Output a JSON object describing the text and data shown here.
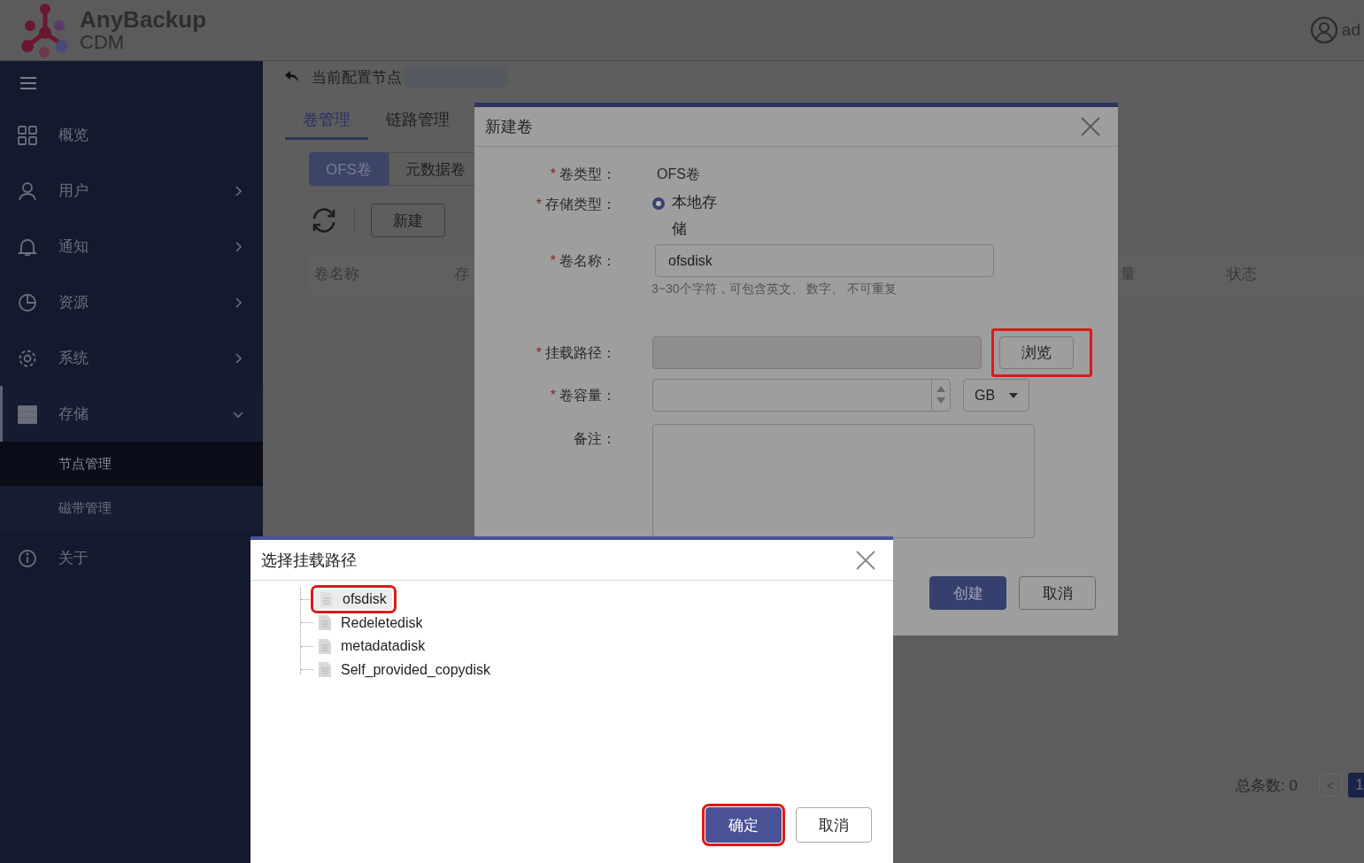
{
  "header": {
    "brand": "AnyBackup",
    "product": "CDM",
    "user": "ad"
  },
  "sidebar": {
    "items": [
      {
        "label": "概览",
        "has_children": false,
        "expanded": false
      },
      {
        "label": "用户",
        "has_children": true,
        "expanded": false
      },
      {
        "label": "通知",
        "has_children": true,
        "expanded": false
      },
      {
        "label": "资源",
        "has_children": true,
        "expanded": false
      },
      {
        "label": "系统",
        "has_children": true,
        "expanded": false
      },
      {
        "label": "存储",
        "has_children": true,
        "expanded": true,
        "children": [
          {
            "label": "节点管理",
            "selected": true
          },
          {
            "label": "磁带管理",
            "selected": false
          }
        ]
      },
      {
        "label": "关于",
        "has_children": false,
        "expanded": false
      }
    ]
  },
  "breadcrumb": {
    "label": "当前配置节点"
  },
  "tabs": [
    {
      "label": "卷管理",
      "selected": true
    },
    {
      "label": "链路管理",
      "selected": false
    }
  ],
  "volume_types": [
    {
      "label": "OFS卷",
      "selected": true
    },
    {
      "label": "元数据卷",
      "selected": false
    }
  ],
  "toolbar": {
    "new_button": "新建"
  },
  "table": {
    "columns": [
      "卷名称",
      "存",
      "量",
      "状态"
    ]
  },
  "pagination": {
    "total": "总条数: 0",
    "prev": "<",
    "prev_disabled": true,
    "pages": [
      {
        "label": "1",
        "selected": true
      }
    ]
  },
  "new_volume_dialog": {
    "title": "新建卷",
    "fields": [
      {
        "kind": "text",
        "required_mark": "*",
        "label": "卷类型：",
        "value": "OFS卷"
      },
      {
        "kind": "radio",
        "required_mark": "*",
        "label": "存储类型：",
        "options": [
          {
            "label": "本地存储",
            "selected": true
          }
        ]
      },
      {
        "kind": "input",
        "required_mark": "*",
        "label": "卷名称：",
        "value": "ofsdisk",
        "hint": "3~30个字符，可包含英文、 数字、 不可重复"
      },
      {
        "kind": "path",
        "required_mark": "*",
        "label": "挂载路径：",
        "disabled": true,
        "button": {
          "label": "浏览",
          "highlighted": true
        }
      },
      {
        "kind": "number",
        "required_mark": "*",
        "label": "卷容量：",
        "unit": "GB"
      },
      {
        "kind": "textarea",
        "label": "备注："
      }
    ],
    "buttons": [
      {
        "label": "创建",
        "primary": true
      },
      {
        "label": "取消",
        "primary": false
      }
    ]
  },
  "path_dialog": {
    "title": "选择挂载路径",
    "tree": [
      {
        "label": "ofsdisk",
        "selected": true,
        "highlighted": true
      },
      {
        "label": "Redeletedisk",
        "selected": false,
        "highlighted": false
      },
      {
        "label": "metadatadisk",
        "selected": false,
        "highlighted": false
      },
      {
        "label": "Self_provided_copydisk",
        "selected": false,
        "highlighted": false
      }
    ],
    "buttons": [
      {
        "label": "确定",
        "primary": true,
        "highlighted": true
      },
      {
        "label": "取消",
        "primary": false,
        "highlighted": false
      }
    ]
  }
}
